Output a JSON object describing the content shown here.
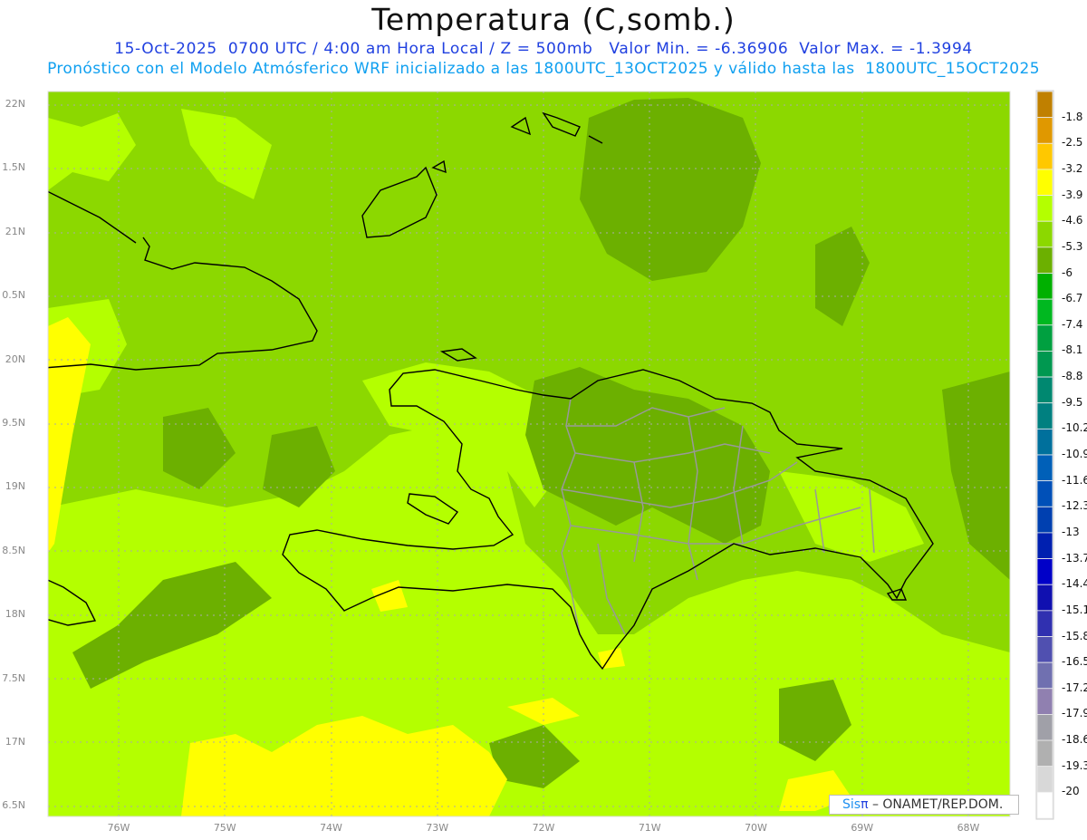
{
  "header": {
    "title": "Temperatura (C,somb.)",
    "line1": "15-Oct-2025  0700 UTC / 4:00 am Hora Local / Z = 500mb   Valor Min. = -6.36906  Valor Max. = -1.3994",
    "line2": "Pronóstico con el Modelo Atmósferico WRF inicializado a las 1800UTC_13OCT2025 y válido hasta las  1800UTC_15OCT2025"
  },
  "map": {
    "region": "Hispaniola / Caribbean",
    "field_colors": {
      "base": "#8cd800",
      "warmer": "#b4ff00",
      "warmest": "#ffff00",
      "cooler": "#6cb000"
    },
    "lat_labels": [
      "22N",
      "1.5N",
      "21N",
      "0.5N",
      "20N",
      "9.5N",
      "19N",
      "8.5N",
      "18N",
      "7.5N",
      "17N",
      "6.5N"
    ],
    "lon_labels": [
      "76W",
      "75W",
      "74W",
      "73W",
      "72W",
      "71W",
      "70W",
      "69W",
      "68W"
    ]
  },
  "colorbar": {
    "labels": [
      "-1.8",
      "-2.5",
      "-3.2",
      "-3.9",
      "-4.6",
      "-5.3",
      "-6",
      "-6.7",
      "-7.4",
      "-8.1",
      "-8.8",
      "-9.5",
      "-10.2",
      "-10.9",
      "-11.6",
      "-12.3",
      "-13",
      "-13.7",
      "-14.4",
      "-15.1",
      "-15.8",
      "-16.5",
      "-17.2",
      "-17.9",
      "-18.6",
      "-19.3",
      "-20"
    ],
    "colors": [
      "#c08000",
      "#e09800",
      "#ffc800",
      "#ffff00",
      "#b4ff00",
      "#8cd800",
      "#6cb000",
      "#00b000",
      "#00b820",
      "#00a040",
      "#009850",
      "#008870",
      "#008080",
      "#00709c",
      "#0060b8",
      "#0050b8",
      "#0040b0",
      "#0020b0",
      "#0000c8",
      "#1010b0",
      "#3030b0",
      "#5050b0",
      "#7070b0",
      "#9080b0",
      "#a0a0a8",
      "#b0b0b0",
      "#d8d8d8",
      "#ffffff"
    ]
  },
  "credit": {
    "logo": "Sis",
    "logo_pi": "π",
    "text": " – ONAMET/REP.DOM."
  }
}
